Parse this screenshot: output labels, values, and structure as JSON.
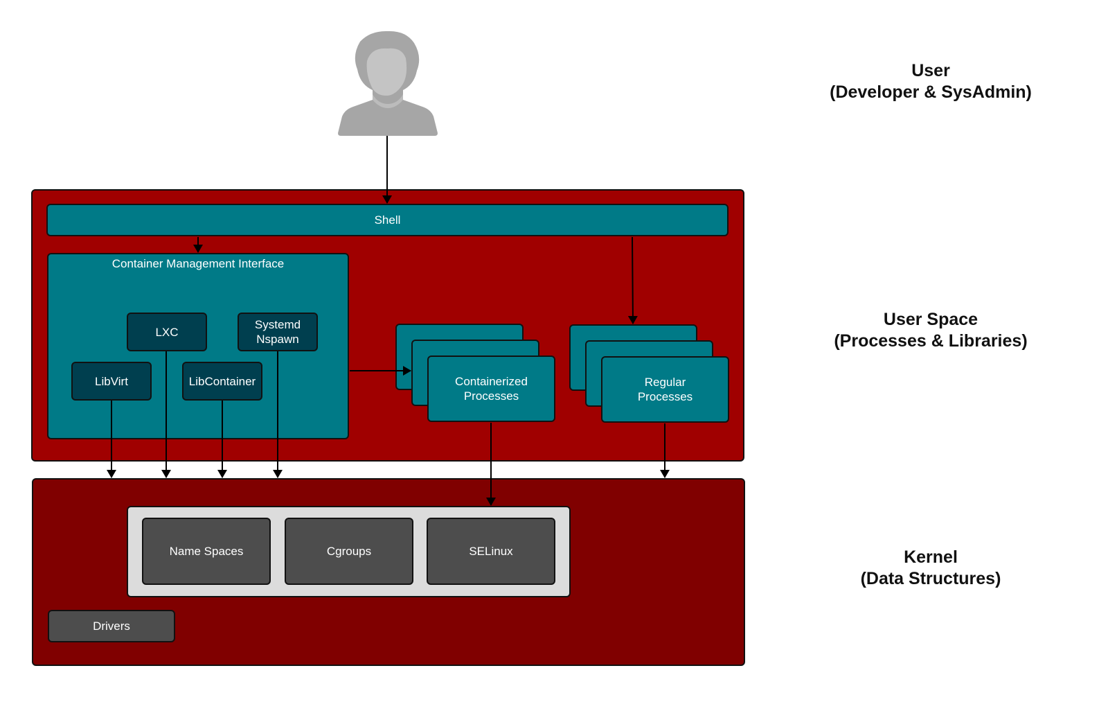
{
  "layers": {
    "user": {
      "title": "User",
      "subtitle": "(Developer & SysAdmin)"
    },
    "user_space": {
      "title": "User Space",
      "subtitle": "(Processes & Libraries)"
    },
    "kernel": {
      "title": "Kernel",
      "subtitle": "(Data Structures)"
    }
  },
  "user_space": {
    "shell": "Shell",
    "container_management_interface": {
      "title": "Container Management Interface",
      "tools": [
        {
          "id": "lxc",
          "label": "LXC"
        },
        {
          "id": "systemd-nspawn",
          "label": "Systemd Nspawn"
        },
        {
          "id": "libvirt",
          "label": "LibVirt"
        },
        {
          "id": "libcontainer",
          "label": "LibContainer"
        }
      ]
    },
    "containerized_processes": "Containerized Processes",
    "regular_processes": "Regular Processes"
  },
  "kernel": {
    "features": [
      "Name Spaces",
      "Cgroups",
      "SELinux"
    ],
    "drivers": "Drivers"
  },
  "colors": {
    "user_space_bg": "#a00000",
    "kernel_bg": "#800000",
    "teal": "#007a87",
    "dark_teal": "#003f4f",
    "gray_box": "#4d4d4d",
    "light_panel": "#dcdcdc",
    "user_icon": "#a6a6a6"
  },
  "icons": {
    "user": "user-avatar-icon"
  }
}
